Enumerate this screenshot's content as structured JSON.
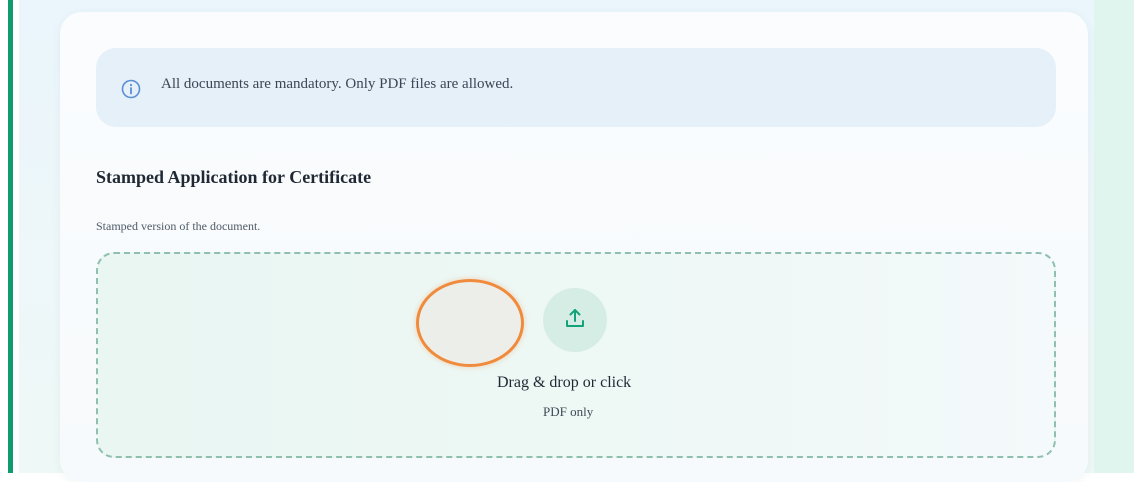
{
  "notice": {
    "text": "All documents are mandatory. Only PDF files are allowed.",
    "icon": "info-circle-icon",
    "color": "#5b8fd6"
  },
  "section": {
    "title": "Stamped Application for Certificate",
    "description": "Stamped version of the document."
  },
  "dropzone": {
    "label": "Drag & drop or click",
    "sublabel": "PDF only",
    "icon": "upload-icon",
    "accent_color": "#12a37a"
  },
  "colors": {
    "left_accent": "#0f9a6f",
    "right_strip": "#dff5ee",
    "cursor_ring": "#f08a3c"
  }
}
